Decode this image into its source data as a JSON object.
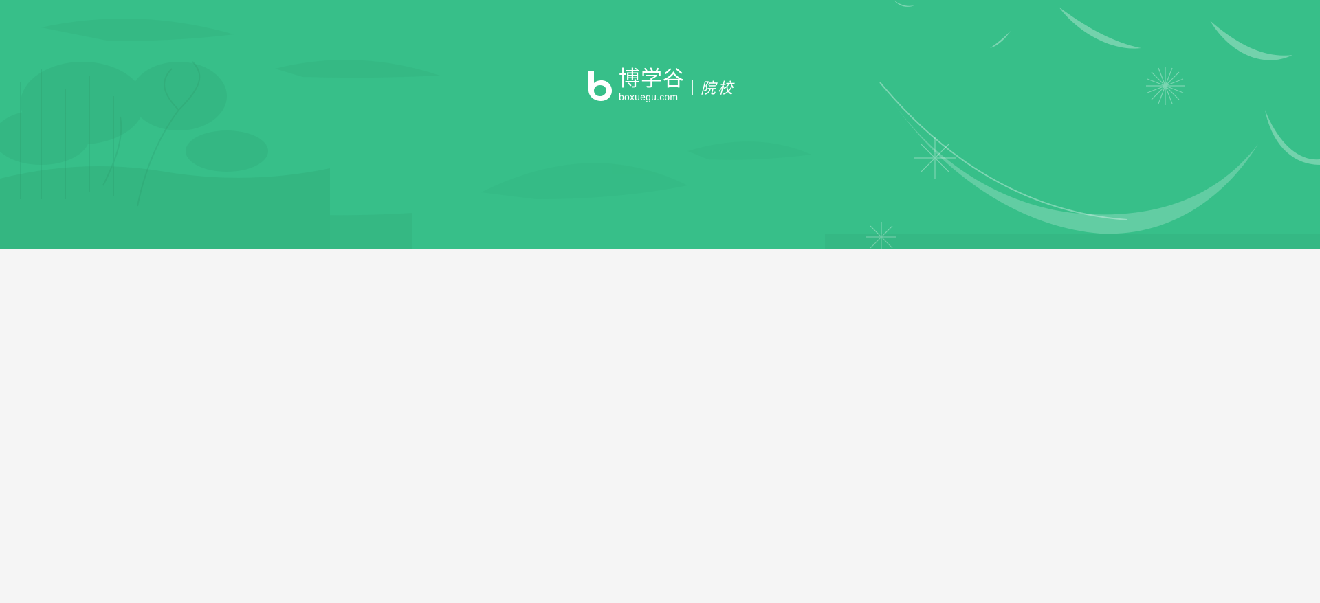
{
  "header": {
    "brand": {
      "icon": "boxuegu-logo-icon",
      "name": "博学谷",
      "domain": "boxuegu.com",
      "section": "院校"
    },
    "colors": {
      "banner_background": "#37bf89",
      "text": "#ffffff"
    },
    "decoration": {
      "left": "landscape-painting-illustration",
      "right": "feather-illustration"
    }
  },
  "page": {
    "background": "#f5f5f5"
  }
}
